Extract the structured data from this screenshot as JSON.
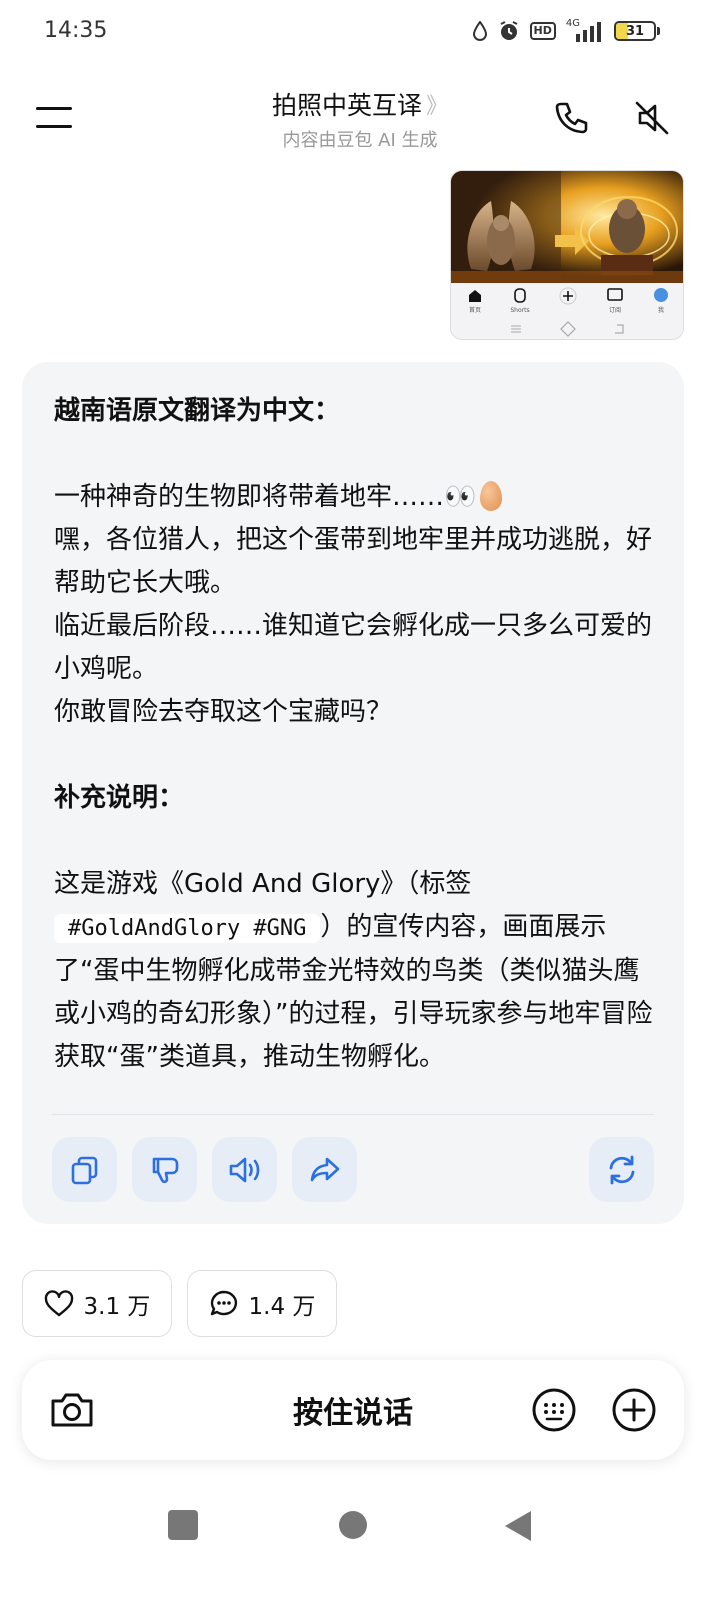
{
  "status_bar": {
    "time": "14:35",
    "hd_label": "HD",
    "network_label": "4G",
    "battery_level": "31",
    "battery_fraction": 0.31,
    "icons": [
      "water-drop-icon",
      "alarm-icon",
      "hd-icon",
      "signal-icon",
      "battery-icon"
    ]
  },
  "header": {
    "title": "拍照中英互译",
    "chevron": "》",
    "subtitle": "内容由豆包 AI 生成",
    "menu_icon": "menu-icon",
    "call_icon": "phone-icon",
    "mute_icon": "speaker-muted-icon"
  },
  "image_message": {
    "nav_labels": [
      "首页",
      "Shorts",
      "订阅",
      "我"
    ]
  },
  "reply": {
    "heading_translation": "越南语原文翻译为中文：",
    "line1": "一种神奇的生物即将带着地牢……👀",
    "line2": "嘿，各位猎人，把这个蛋带到地牢里并成功逃脱，好帮助它长大哦。",
    "line3": "临近最后阶段……谁知道它会孵化成一只多么可爱的小鸡呢。",
    "line4": "你敢冒险去夺取这个宝藏吗？",
    "heading_note": "补充说明：",
    "note_part1": "这是游戏《Gold And Glory》（标签",
    "note_tags": "#GoldAndGlory #GNG",
    "note_part2": "）的宣传内容，画面展示了“蛋中生物孵化成带金光特效的鸟类（类似猫头鹰或小鸡的奇幻形象）”的过程，引导玩家参与地牢冒险获取“蛋”类道具，推动生物孵化。",
    "actions": [
      "copy-icon",
      "thumbs-down-icon",
      "speaker-icon",
      "share-icon",
      "regenerate-icon"
    ]
  },
  "stats": {
    "likes": "3.1 万",
    "comments": "1.4 万"
  },
  "composer": {
    "hold_to_talk": "按住说话",
    "icons": [
      "camera-icon",
      "keyboard-icon",
      "plus-icon"
    ]
  },
  "colors": {
    "accent": "#2c6fe0",
    "card_bg": "#f4f5f7",
    "action_bg": "#e7edf7"
  }
}
